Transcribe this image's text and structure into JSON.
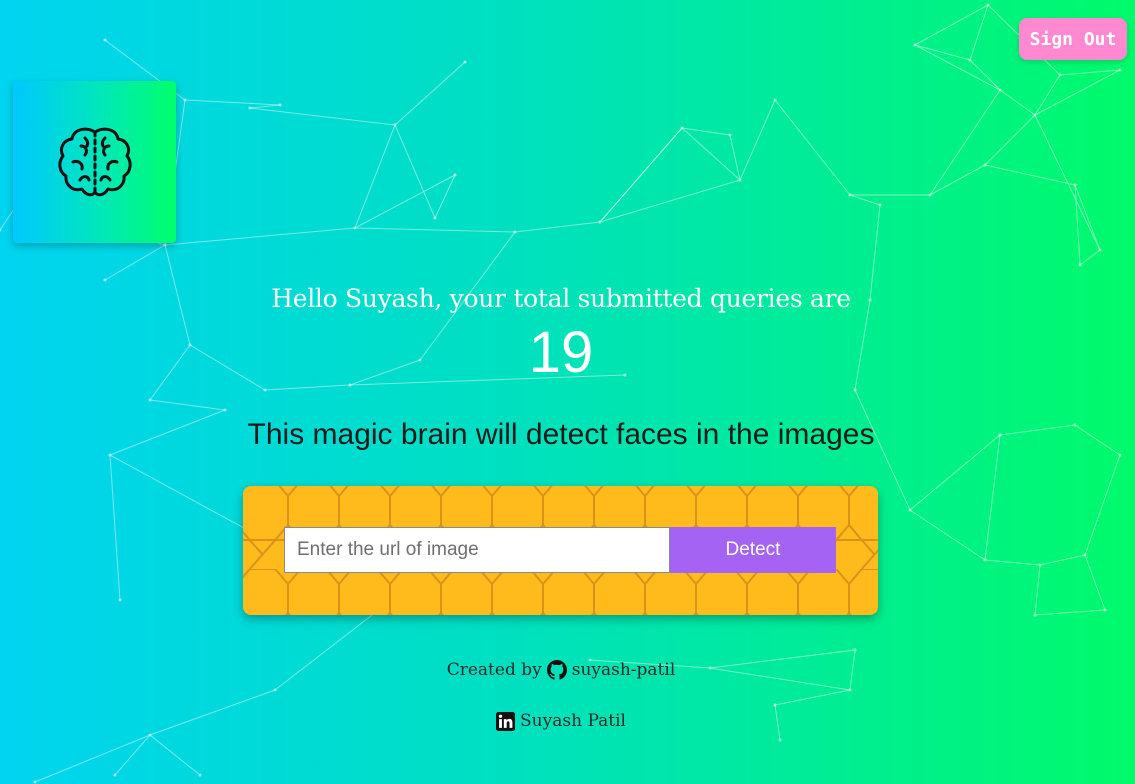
{
  "header": {
    "signout_label": "Sign Out"
  },
  "logo": {
    "icon": "brain-icon"
  },
  "rank": {
    "greeting": "Hello Suyash, your total submitted queries are",
    "count": "19"
  },
  "tagline": "This magic brain will detect faces in the images",
  "form": {
    "placeholder": "Enter the url of image",
    "value": "",
    "detect_label": "Detect"
  },
  "footer": {
    "created_by": "Created by",
    "github_icon": "github-icon",
    "github_user": "suyash-patil",
    "linkedin_icon": "linkedin-icon",
    "linkedin_name": "Suyash Patil"
  },
  "colors": {
    "signout": "#ff89d1",
    "panel": "#ffbb1c",
    "detect": "#a463f2"
  }
}
